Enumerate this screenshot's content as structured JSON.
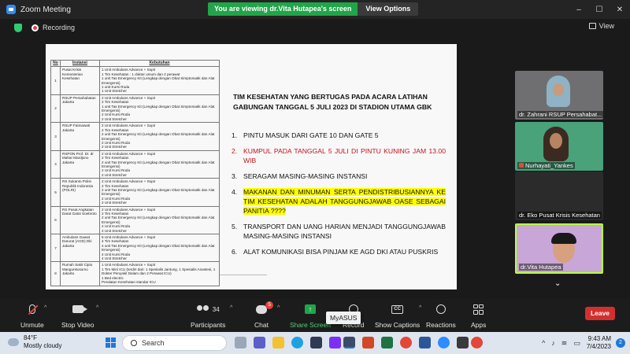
{
  "window": {
    "title": "Zoom Meeting",
    "viewing_message": "You are viewing dr.Vita Hutapea's screen",
    "view_options_label": "View Options",
    "controls": {
      "minimize": "–",
      "maximize": "☐",
      "close": "✕"
    }
  },
  "topbar": {
    "recording_label": "Recording",
    "view_label": "View"
  },
  "slide": {
    "table": {
      "headers": [
        "No",
        "Instansi",
        "Kebutuhan"
      ],
      "rows": [
        {
          "no": "1",
          "instansi": "Pusat Krisis Kementerian Kesehatan",
          "kebutuhan": [
            "1 Unit Ambulans Advance + Supir",
            "1 Tim Kesehatan : 1 dokter umum dan 2 perawat",
            "1 unit Tas Emergency Kit (Lengkap dengan Obat Simptomatik dan Alat Emergensi)",
            "1 unit Kursi Roda",
            "1 Unit Stretcher"
          ]
        },
        {
          "no": "2",
          "instansi": "RSUP Persahabatan Jakarta",
          "kebutuhan": [
            "2 Unit Ambulans Advance + Supir",
            "2 Tim Kesehatan",
            "1 unit Tas Emergency Kit (Lengkap dengan Obat Simptomatik dan Alat Emergensi)",
            "2 Unit Kursi Roda",
            "2 Unit Stretcher"
          ]
        },
        {
          "no": "3",
          "instansi": "RSUP Fatmawati Jakarta",
          "kebutuhan": [
            "2 Unit Ambulans Advance + Supir",
            "2 Tim Kesehatan",
            "2 unit Tas Emergency Kit (Lengkap dengan Obat Simptomatik dan Alat Emergensi)",
            "2 Unit Kursi Roda",
            "2 Unit Stretcher"
          ]
        },
        {
          "no": "4",
          "instansi": "RSPON Prof. Dr. dr Mahar Mardjono Jakarta",
          "kebutuhan": [
            "2 Unit Ambulans Advance + Supir",
            "2 Tim Kesehatan",
            "2 unit Tas Emergency Kit (Lengkap dengan Obat Simptomatik dan Alat Emergensi)",
            "2 Unit Kursi Roda",
            "2 Unit Stretcher"
          ]
        },
        {
          "no": "5",
          "instansi": "RS Sukanto Polisi Republik Indonesia (POLRI)",
          "kebutuhan": [
            "2 Unit Ambulans Advance + Supir",
            "2 Tim Kesehatan",
            "2 unit Tas Emergency Kit (Lengkap dengan Obat Simptomatik dan Alat Emergensi)",
            "2 Unit Kursi Roda",
            "2 Unit Stretcher"
          ]
        },
        {
          "no": "6",
          "instansi": "RS Pusat Angkatan Darat Gatot Soebroto",
          "kebutuhan": [
            "2 Unit Ambulans Advance + Supir",
            "2 Tim Kesehatan",
            "2 unit Tas Emergency Kit (Lengkap dengan Obat Simptomatik dan Alat Emergensi)",
            "2 Unit Kursi Roda",
            "2 Unit Stretcher"
          ]
        },
        {
          "no": "7",
          "instansi": "Ambulans Gawat Darurat (AGD) Dki Jakarta",
          "kebutuhan": [
            "5 Unit Ambulans Advance + Supir",
            "4 Tim Kesehatan",
            "4 unit Tas Emergency Kit (Lengkap dengan Obat Simptomatik dan Alat Emergensi)",
            "4 Unit Kursi Roda",
            "4 Unit Stretcher"
          ]
        },
        {
          "no": "8",
          "instansi": "Rumah Sakit Cipto Mangunkusumo Jakarta",
          "kebutuhan": [
            "1 Unit Ambulans Advance + Supir",
            "1 Tim Mini ICU (terdiri dari: 1 Spesialis Jantung, 1 Spesialis Anastesi, 1 Dokter Penyakit Dalam dan 2 Perawat ICU)",
            "1 Bed electric",
            "Peralatan Kesehatan standar ICU"
          ]
        }
      ]
    },
    "heading": "TIM KESEHATAN YANG BERTUGAS PADA ACARA LATIHAN GABUNGAN TANGGAL 5 JULI 2023 DI STADION UTAMA GBK",
    "items": [
      {
        "num": "1.",
        "text": "PINTU MASUK DARI GATE 10 DAN GATE 5",
        "style": "normal"
      },
      {
        "num": "2.",
        "text": "KUMPUL PADA TANGGAL 5 JULI DI PINTU KUNING JAM 13.00 WIB",
        "style": "red"
      },
      {
        "num": "3.",
        "text": "SERAGAM MASING-MASING INSTANSI",
        "style": "normal"
      },
      {
        "num": "4.",
        "text": "MAKANAN DAN MINUMAN SERTA PENDISTRIBUSIANNYA KE TIM KESEHATAN ADALAH TANGGUNGJAWAB OASE SEBAGAI PANITIA ????",
        "style": "highlight"
      },
      {
        "num": "5.",
        "text": "TRANSPORT DAN UANG HARIAN MENJADI TANGGUNGJAWAB MASING-MASING INSTANSI",
        "style": "normal"
      },
      {
        "num": "6.",
        "text": "ALAT KOMUNIKASI BISA PINJAM KE AGD DKI ATAU PUSKRIS",
        "style": "normal"
      }
    ]
  },
  "participants": [
    {
      "name": "dr. Zahrani RSUP Persahabat..."
    },
    {
      "name": "Nurhayati_Yankes"
    },
    {
      "name": "dr. Eko Pusat Krisis Kesehatan"
    },
    {
      "name": "dr.Vita Hutapea"
    }
  ],
  "toolbar": {
    "unmute": "Unmute",
    "stop_video": "Stop Video",
    "participants": "Participants",
    "participants_count": "34",
    "chat": "Chat",
    "chat_badge": "5",
    "share_screen": "Share Screen",
    "record": "Record",
    "show_captions": "Show Captions",
    "captions_icon": "CC",
    "reactions": "Reactions",
    "apps": "Apps",
    "leave": "Leave",
    "tooltip": "MyASUS"
  },
  "taskbar": {
    "temperature": "84°F",
    "weather": "Mostly cloudy",
    "search_placeholder": "Search",
    "time": "9:43 AM",
    "date": "7/4/2023",
    "notifications": "2"
  },
  "colors": {
    "accent": "#2d8cff",
    "banner_green": "#21a549",
    "leave_red": "#d32f2f",
    "highlight": "#ffff00",
    "red_text": "#c0141c"
  }
}
